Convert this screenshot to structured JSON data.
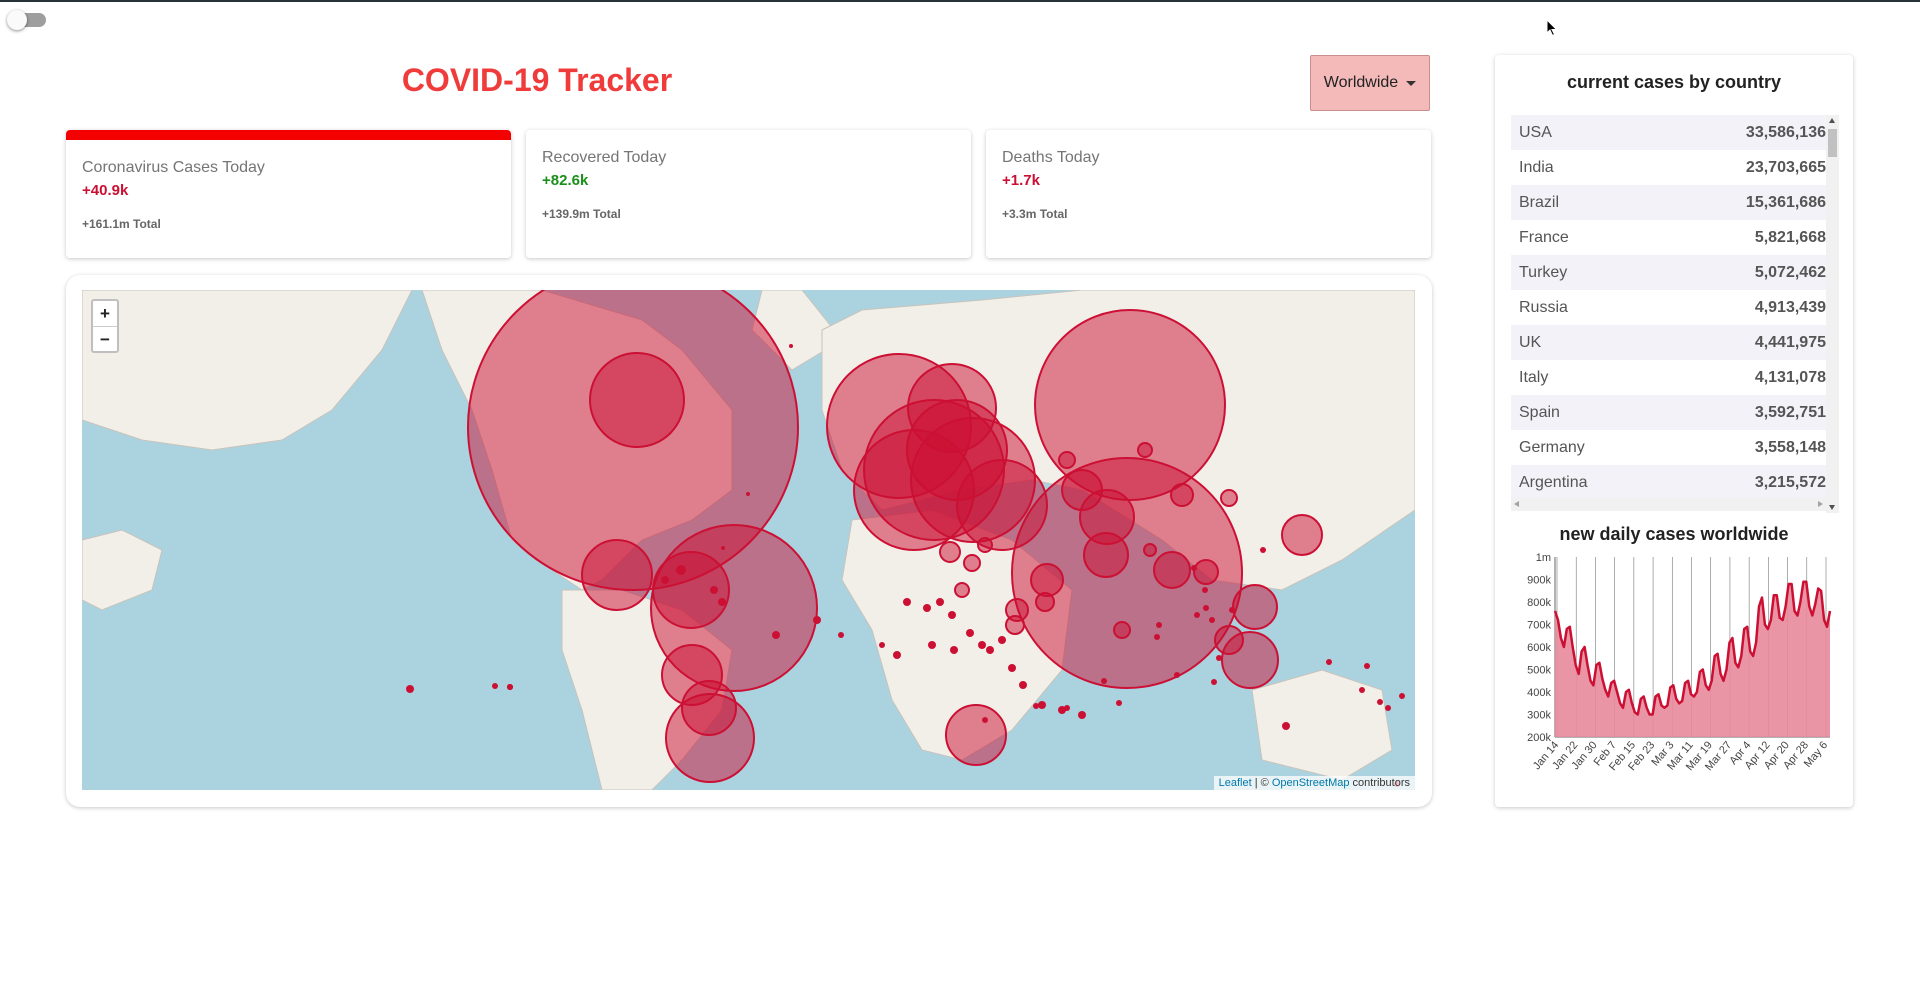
{
  "header": {
    "title": "COVID-19 Tracker",
    "country_select": "Worldwide"
  },
  "infoboxes": [
    {
      "title": "Coronavirus Cases Today",
      "value": "+40.9k",
      "total": "+161.1m Total",
      "active": true
    },
    {
      "title": "Recovered Today",
      "value": "+82.6k",
      "total": "+139.9m Total",
      "active": false
    },
    {
      "title": "Deaths Today",
      "value": "+1.7k",
      "total": "+3.3m Total",
      "active": false
    }
  ],
  "map": {
    "zoom_in": "+",
    "zoom_out": "−",
    "attribution": {
      "leaflet": "Leaflet",
      "separator": " | © ",
      "osm": "OpenStreetMap",
      "suffix": " contributors"
    }
  },
  "sidebar": {
    "table_title": "current cases by country",
    "countries": [
      {
        "name": "USA",
        "cases": "33,586,136"
      },
      {
        "name": "India",
        "cases": "23,703,665"
      },
      {
        "name": "Brazil",
        "cases": "15,361,686"
      },
      {
        "name": "France",
        "cases": "5,821,668"
      },
      {
        "name": "Turkey",
        "cases": "5,072,462"
      },
      {
        "name": "Russia",
        "cases": "4,913,439"
      },
      {
        "name": "UK",
        "cases": "4,441,975"
      },
      {
        "name": "Italy",
        "cases": "4,131,078"
      },
      {
        "name": "Spain",
        "cases": "3,592,751"
      },
      {
        "name": "Germany",
        "cases": "3,558,148"
      },
      {
        "name": "Argentina",
        "cases": "3,215,572"
      }
    ],
    "chart_title": "new daily cases worldwide"
  },
  "colors": {
    "accent": "#cc1034",
    "fill": "#e8899b",
    "title": "#f03b3b",
    "button": "#f4b9b9",
    "ocean": "#aad3df"
  },
  "chart_data": {
    "type": "area",
    "title": "new daily cases worldwide",
    "xlabel": "",
    "ylabel": "",
    "ylim": [
      200000,
      1000000
    ],
    "yticks": [
      "200k",
      "300k",
      "400k",
      "500k",
      "600k",
      "700k",
      "800k",
      "900k",
      "1m"
    ],
    "xticks": [
      "Jan 14",
      "Jan 22",
      "Jan 30",
      "Feb 7",
      "Feb 15",
      "Feb 23",
      "Mar 3",
      "Mar 11",
      "Mar 19",
      "Mar 27",
      "Apr 4",
      "Apr 12",
      "Apr 20",
      "Apr 28",
      "May 6"
    ],
    "series": [
      {
        "values": [
          760000,
          720000,
          640000,
          600000,
          680000,
          690000,
          600000,
          520000,
          480000,
          580000,
          600000,
          520000,
          450000,
          430000,
          520000,
          530000,
          460000,
          410000,
          380000,
          440000,
          450000,
          400000,
          350000,
          330000,
          400000,
          410000,
          350000,
          310000,
          300000,
          370000,
          380000,
          330000,
          300000,
          300000,
          380000,
          390000,
          340000,
          330000,
          340000,
          420000,
          430000,
          370000,
          350000,
          360000,
          440000,
          450000,
          390000,
          380000,
          400000,
          490000,
          500000,
          430000,
          410000,
          450000,
          560000,
          570000,
          480000,
          450000,
          500000,
          620000,
          640000,
          530000,
          510000,
          560000,
          680000,
          690000,
          580000,
          560000,
          620000,
          780000,
          820000,
          700000,
          680000,
          720000,
          830000,
          830000,
          730000,
          720000,
          780000,
          880000,
          880000,
          760000,
          740000,
          800000,
          890000,
          890000,
          780000,
          740000,
          790000,
          860000,
          850000,
          720000,
          690000,
          760000
        ]
      }
    ]
  }
}
